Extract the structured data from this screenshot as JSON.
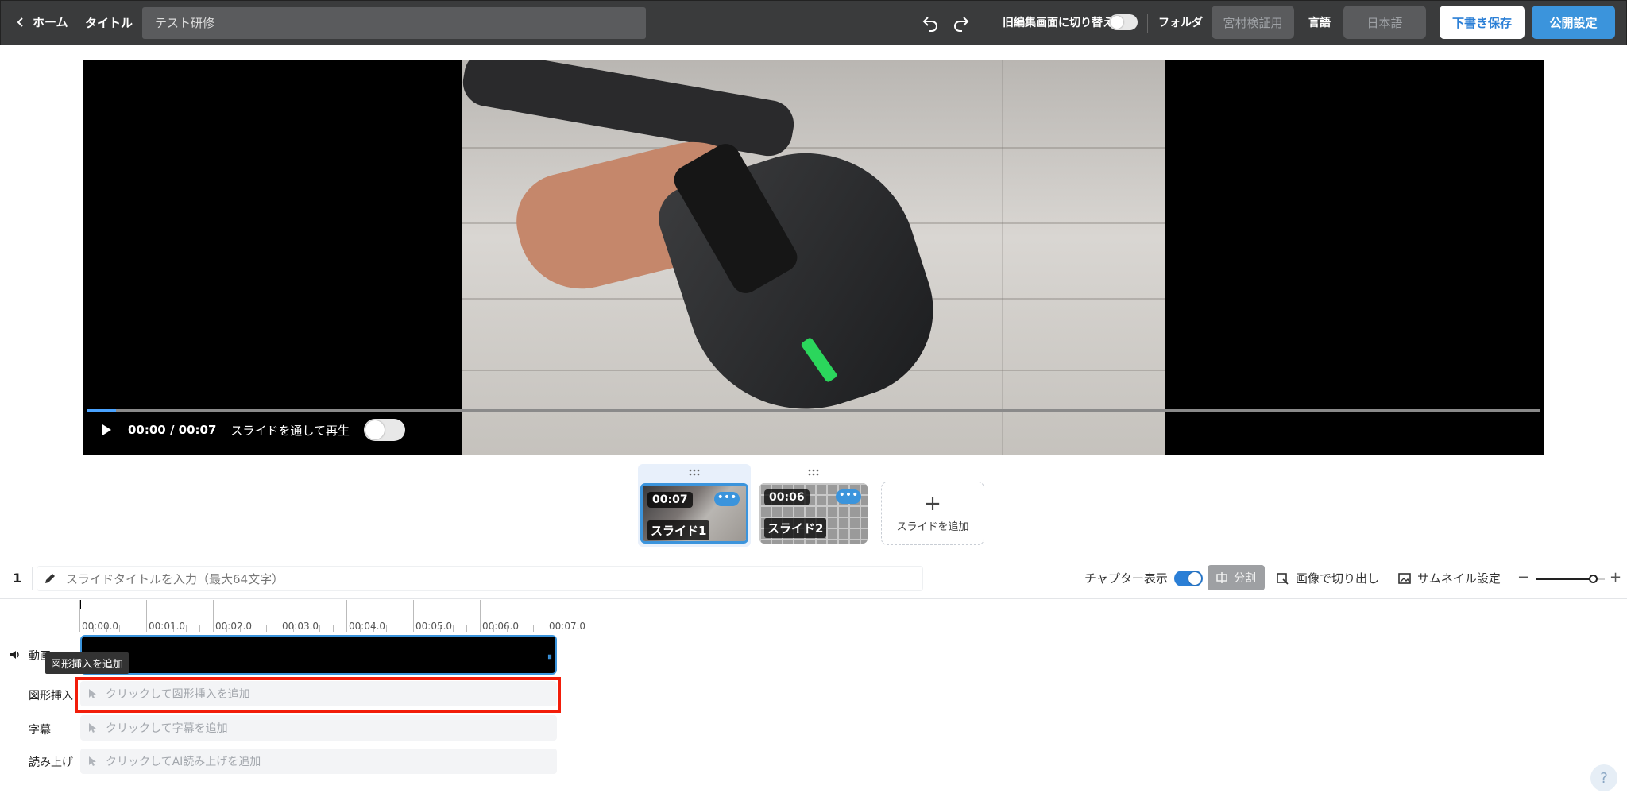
{
  "topbar": {
    "back_label": "ホーム",
    "title_label": "タイトル",
    "title_value": "テスト研修",
    "switch_label": "旧編集画面に切り替え",
    "folder_label": "フォルダ",
    "folder_value": "宮村検証用",
    "language_label": "言語",
    "language_value": "日本語",
    "save_draft_label": "下書き保存",
    "publish_label": "公開設定"
  },
  "player": {
    "time": "00:00 / 00:07",
    "through_slides_label": "スライドを通して再生",
    "progress": 0.02
  },
  "slides": [
    {
      "duration": "00:07",
      "name": "スライド1",
      "more": "•••"
    },
    {
      "duration": "00:06",
      "name": "スライド2",
      "more": "•••"
    }
  ],
  "add_slide": {
    "plus": "+",
    "label": "スライドを追加"
  },
  "slide_editor": {
    "number": "1",
    "title_placeholder": "スライドタイトルを入力（最大64文字）",
    "chapter_label": "チャプター表示",
    "split_label": "分割",
    "crop_label": "画像で切り出し",
    "thumbnail_label": "サムネイル設定",
    "zoom_minus": "−",
    "zoom_plus": "+"
  },
  "timeline": {
    "ticks": [
      "00:00.0",
      "00:01.0",
      "00:02.0",
      "00:03.0",
      "00:04.0",
      "00:05.0",
      "00:06.0",
      "00:07.0"
    ],
    "tracks": {
      "video": "動画",
      "shape": "図形挿入",
      "subtitle": "字幕",
      "narration": "読み上げ"
    },
    "tooltip": "図形挿入を追加",
    "shape_placeholder": "クリックして図形挿入を追加",
    "subtitle_placeholder": "クリックして字幕を追加",
    "narration_placeholder": "クリックしてAI読み上げを追加"
  },
  "help": "?",
  "colors": {
    "accent": "#3b94dc",
    "highlight": "#f21d0a",
    "topbar": "#3a3b3c"
  }
}
